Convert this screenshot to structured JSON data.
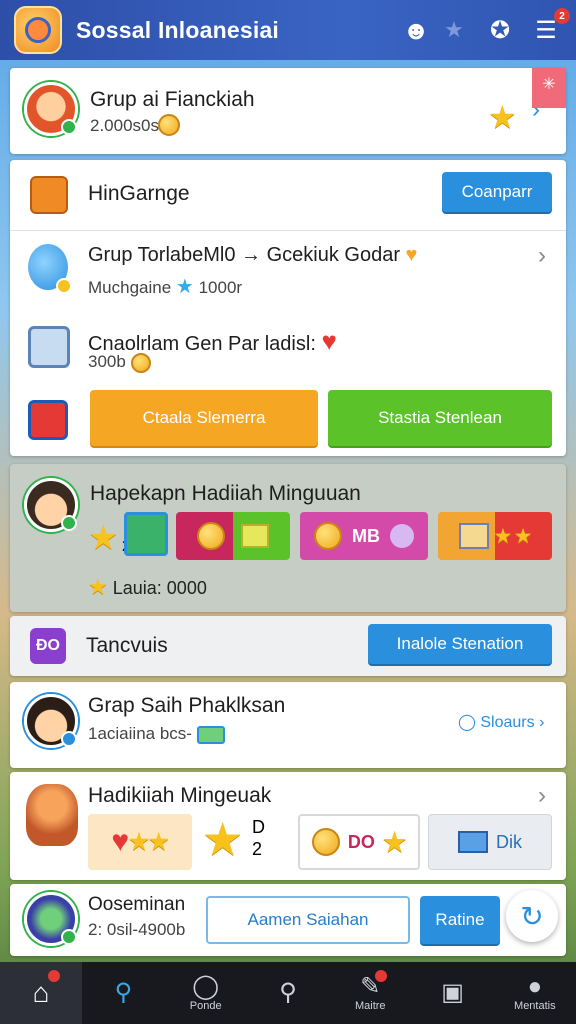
{
  "header": {
    "title": "Sossal Inloanesiai",
    "icons": [
      "logo-icon",
      "smiley-icon",
      "star-icon",
      "star-badge-icon",
      "menu-icon"
    ],
    "menu_badge": "2"
  },
  "group_invite": {
    "title": "Grup ai Fianckiah",
    "subtitle": "2.000s0s"
  },
  "game_card": {
    "title": "HinGarnge",
    "button": "Coanparr"
  },
  "group_ranked": {
    "title": "Grup TorlabeMl0 → Gcekiuk Godar",
    "subtitle_left": "Muchgaine",
    "subtitle_right": "1000r"
  },
  "challenge": {
    "title": "Cnaolrlam Gen Par ladisl:",
    "count": "300b"
  },
  "action_buttons": {
    "left": "Ctaala Slemerra",
    "right": "Stastia Stenlean"
  },
  "weekly_reward": {
    "title": "Hapekapn Hadiiah Minguuan",
    "count": "2",
    "tile_badge": "MB",
    "total": "Lauia: 0000"
  },
  "tarcvuis": {
    "icon_text": "ĐO",
    "label": "Tancvuis",
    "button": "Inalole Stenation"
  },
  "group_search": {
    "title": "Grap Saih Phaklksan",
    "subtitle": "1aciaiina bcs-",
    "link": "Sloaurs"
  },
  "weekly_reward_2": {
    "title": "Hadikiiah Mingeuak",
    "count_top": "D",
    "count_bottom": "2",
    "tile_badge": "DO",
    "tile_label": "Dik"
  },
  "profile_row": {
    "title": "Ooseminan",
    "subtitle": "2: 0sil-4900b",
    "button_outline": "Aamen Saiahan",
    "button_blue": "Ratine"
  },
  "bottom_nav": {
    "items": [
      {
        "label": "",
        "icon": "home-icon"
      },
      {
        "label": "",
        "icon": "search-icon"
      },
      {
        "label": "Ponde",
        "icon": "circle-icon"
      },
      {
        "label": "",
        "icon": "search-icon"
      },
      {
        "label": "Maitre",
        "icon": "edit-icon"
      },
      {
        "label": "",
        "icon": "square-icon"
      },
      {
        "label": "Mentatis",
        "icon": "user-icon"
      }
    ]
  },
  "colors": {
    "header": "#2d4fa8",
    "accent_blue": "#2a8fdc",
    "orange": "#f5a623",
    "green": "#5cc22a",
    "nav_bg": "#17191f"
  }
}
